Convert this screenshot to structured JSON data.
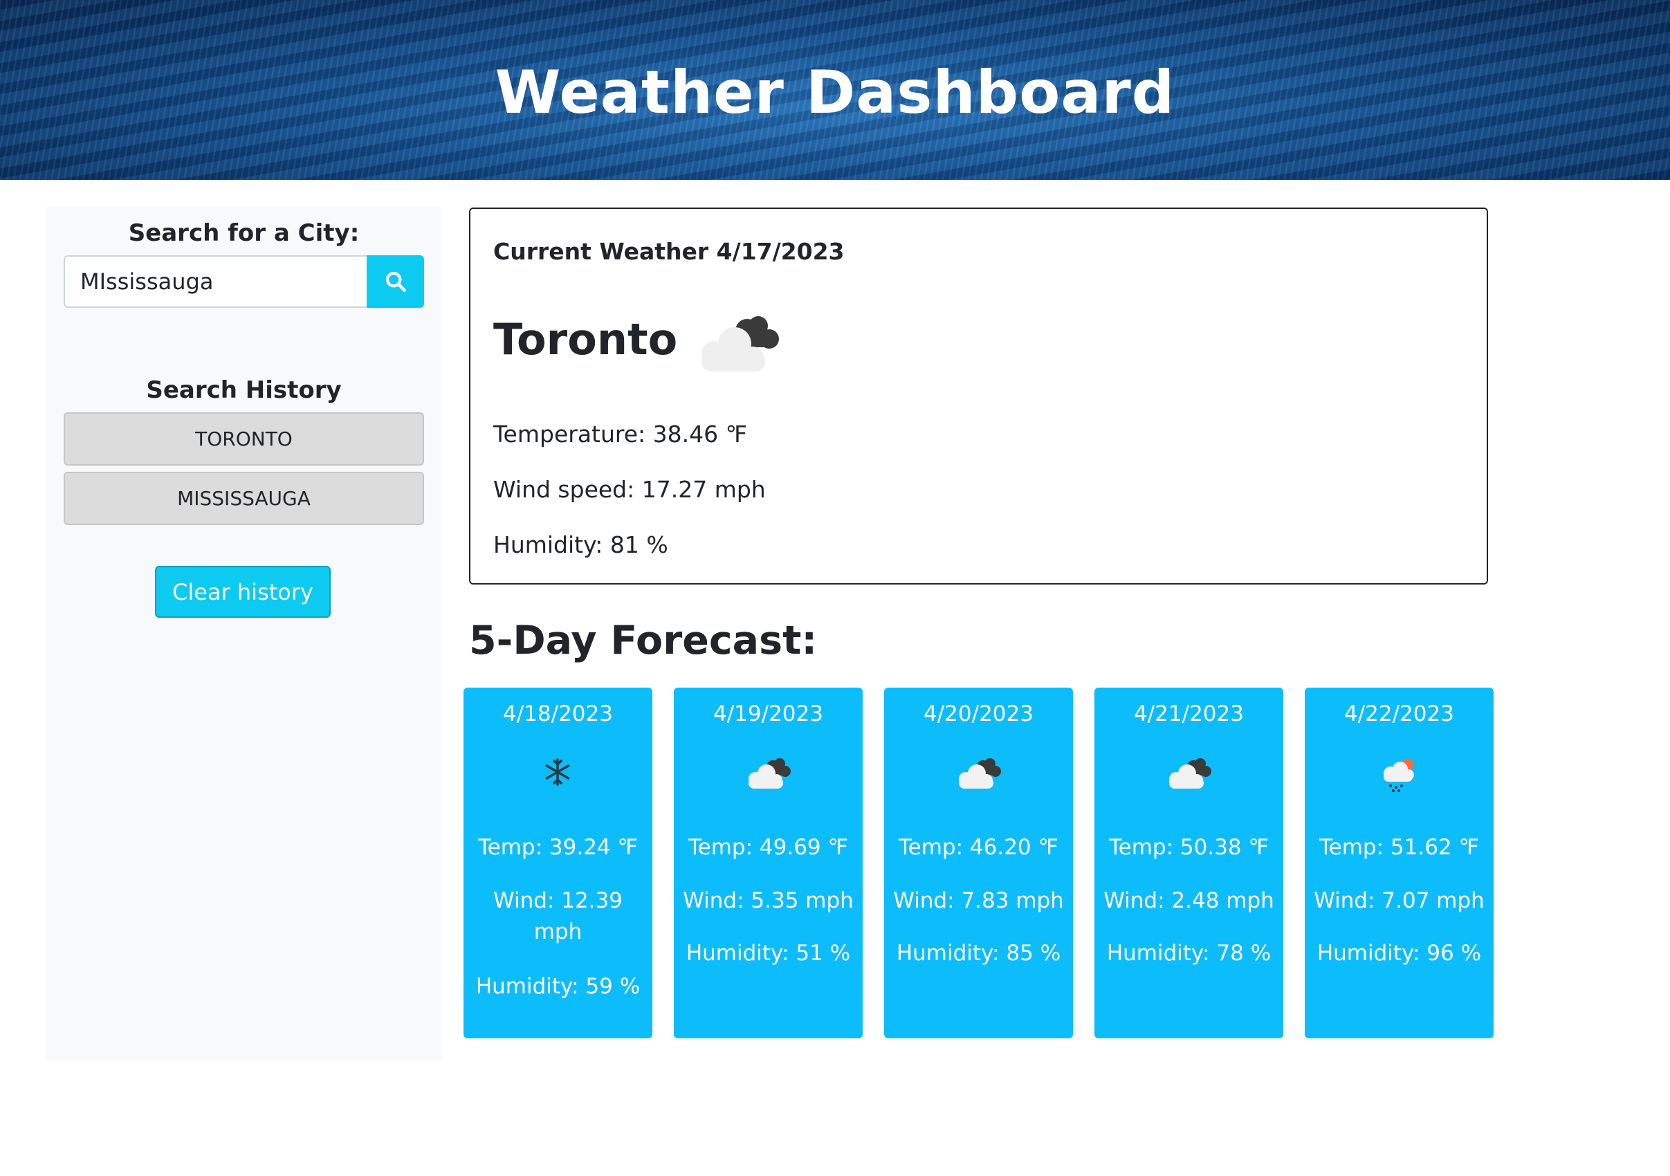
{
  "header": {
    "title": "Weather Dashboard"
  },
  "sidebar": {
    "search_title": "Search for a City:",
    "search_value": "MIssissauga",
    "search_button_icon": "search-icon",
    "history_title": "Search History",
    "history": [
      "TORONTO",
      "MISSISSAUGA"
    ],
    "clear_label": "Clear history"
  },
  "current": {
    "heading": "Current Weather 4/17/2023",
    "city": "Toronto",
    "icon": "cloud-icon",
    "temperature": "Temperature: 38.46 ℉",
    "wind": "Wind speed: 17.27 mph",
    "humidity": "Humidity: 81 %"
  },
  "forecast": {
    "title": "5-Day Forecast:",
    "days": [
      {
        "date": "4/18/2023",
        "icon": "snowflake-icon",
        "temp": "Temp: 39.24 ℉",
        "wind": "Wind: 12.39 mph",
        "humidity": "Humidity: 59 %"
      },
      {
        "date": "4/19/2023",
        "icon": "cloud-icon",
        "temp": "Temp: 49.69 ℉",
        "wind": "Wind: 5.35 mph",
        "humidity": "Humidity: 51 %"
      },
      {
        "date": "4/20/2023",
        "icon": "cloud-icon",
        "temp": "Temp: 46.20 ℉",
        "wind": "Wind: 7.83 mph",
        "humidity": "Humidity: 85 %"
      },
      {
        "date": "4/21/2023",
        "icon": "cloud-icon",
        "temp": "Temp: 50.38 ℉",
        "wind": "Wind: 2.48 mph",
        "humidity": "Humidity: 78 %"
      },
      {
        "date": "4/22/2023",
        "icon": "rain-icon",
        "temp": "Temp: 51.62 ℉",
        "wind": "Wind: 7.07 mph",
        "humidity": "Humidity: 96 %"
      }
    ]
  },
  "colors": {
    "accent": "#0dcaf0",
    "card": "#0dbcfb",
    "text": "#212529"
  }
}
